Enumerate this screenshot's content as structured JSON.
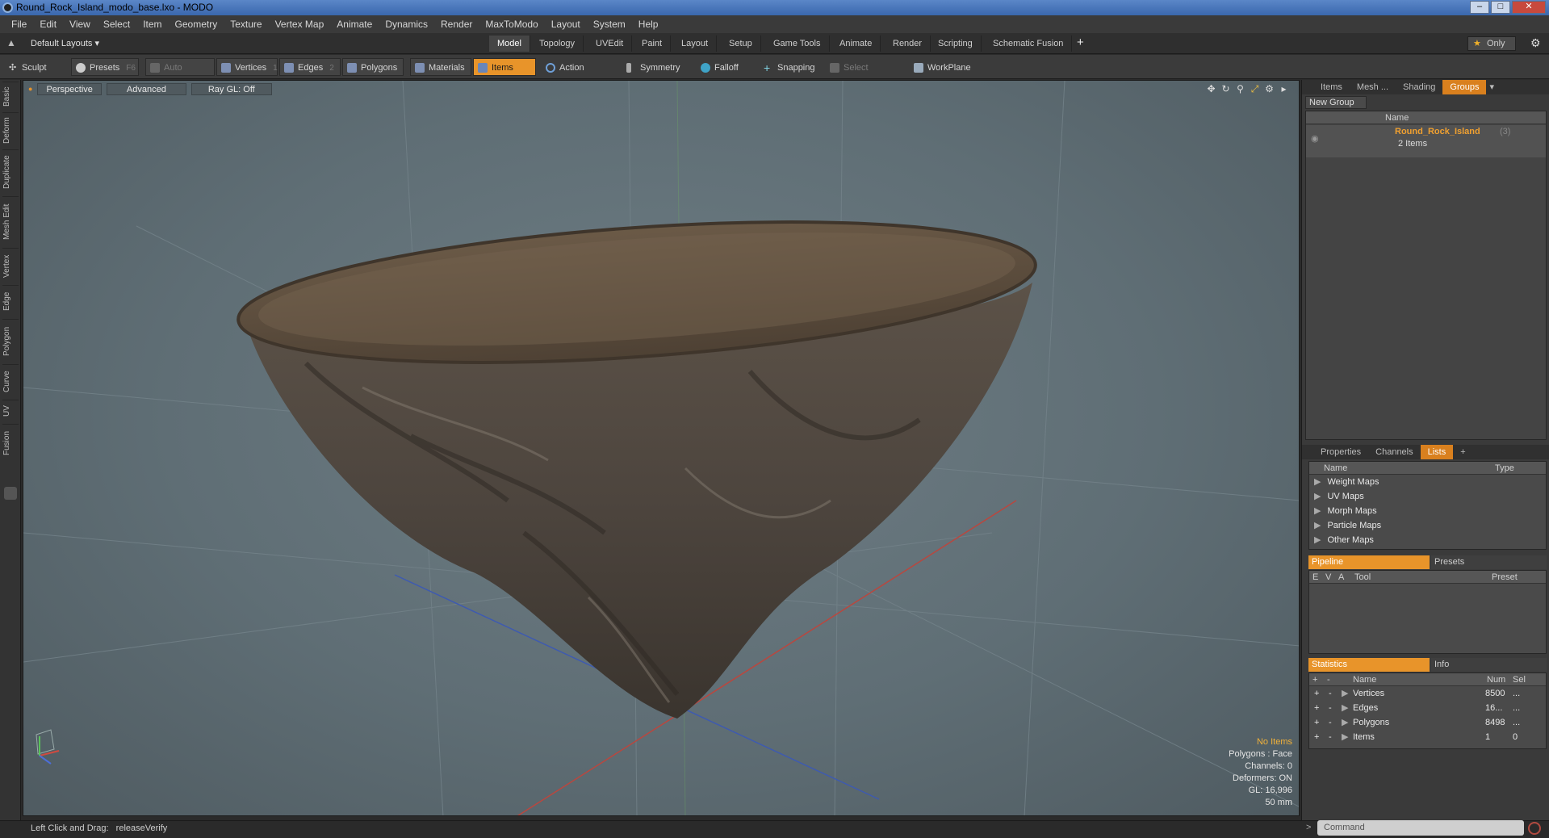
{
  "window": {
    "title": "Round_Rock_Island_modo_base.lxo - MODO"
  },
  "menu": [
    "File",
    "Edit",
    "View",
    "Select",
    "Item",
    "Geometry",
    "Texture",
    "Vertex Map",
    "Animate",
    "Dynamics",
    "Render",
    "MaxToModo",
    "Layout",
    "System",
    "Help"
  ],
  "layout": {
    "selector": "Default Layouts ▾",
    "tabs": [
      "Model",
      "Topology",
      "UVEdit",
      "Paint",
      "Layout",
      "Setup",
      "Game Tools",
      "Animate",
      "Render",
      "Scripting",
      "Schematic Fusion"
    ],
    "add": "+",
    "only": "Only",
    "only_icon": "star-icon"
  },
  "toolbar": {
    "sculpt": "Sculpt",
    "presets": "Presets",
    "presets_key": "F6",
    "auto_select": "Auto Select",
    "vertices": "Vertices",
    "vertices_key": "1",
    "edges": "Edges",
    "edges_key": "2",
    "polygons": "Polygons",
    "materials": "Materials",
    "items": "Items",
    "action_center": "Action Center",
    "symmetry": "Symmetry",
    "falloff": "Falloff",
    "snapping": "Snapping",
    "select_through": "Select Through",
    "workplane": "WorkPlane"
  },
  "left_tabs": [
    "Basic",
    "Deform",
    "Duplicate",
    "Mesh Edit",
    "Vertex",
    "Edge",
    "Polygon",
    "Curve",
    "UV",
    "Fusion"
  ],
  "viewport": {
    "perspective": "Perspective",
    "advanced": "Advanced",
    "raygl": "Ray GL: Off",
    "info": {
      "no_items": "No Items",
      "polygons": "Polygons : Face",
      "channels": "Channels: 0",
      "deformers": "Deformers: ON",
      "gl": "GL: 16,996",
      "scale": "50 mm"
    }
  },
  "groups_panel": {
    "tabs": [
      "Items",
      "Mesh ...",
      "Shading",
      "Groups"
    ],
    "active_tab": "Groups",
    "new_group": "New Group",
    "name_col": "Name",
    "group_name": "Round_Rock_Island",
    "group_count": "(3)",
    "group_sub": "2 Items"
  },
  "lists_panel": {
    "tabs": [
      "Properties",
      "Channels",
      "Lists"
    ],
    "active_tab": "Lists",
    "add": "+",
    "col_name": "Name",
    "col_type": "Type",
    "items": [
      "Weight Maps",
      "UV Maps",
      "Morph Maps",
      "Particle Maps",
      "Other Maps"
    ]
  },
  "pipeline_panel": {
    "tab_pipeline": "Pipeline",
    "tab_presets": "Presets",
    "col_e": "E",
    "col_v": "V",
    "col_a": "A",
    "col_tool": "Tool",
    "col_preset": "Preset"
  },
  "stats_panel": {
    "tab_stats": "Statistics",
    "tab_info": "Info",
    "col_name": "Name",
    "col_num": "Num",
    "col_sel": "Sel",
    "rows": [
      {
        "name": "Vertices",
        "num": "8500",
        "sel": "..."
      },
      {
        "name": "Edges",
        "num": "16...",
        "sel": "..."
      },
      {
        "name": "Polygons",
        "num": "8498",
        "sel": "..."
      },
      {
        "name": "Items",
        "num": "1",
        "sel": "0"
      }
    ]
  },
  "status": {
    "left_label": "Left Click and Drag:",
    "left_value": "releaseVerify",
    "command_placeholder": "Command"
  },
  "colors": {
    "accent": "#e8942a",
    "viewport": "#647278"
  }
}
